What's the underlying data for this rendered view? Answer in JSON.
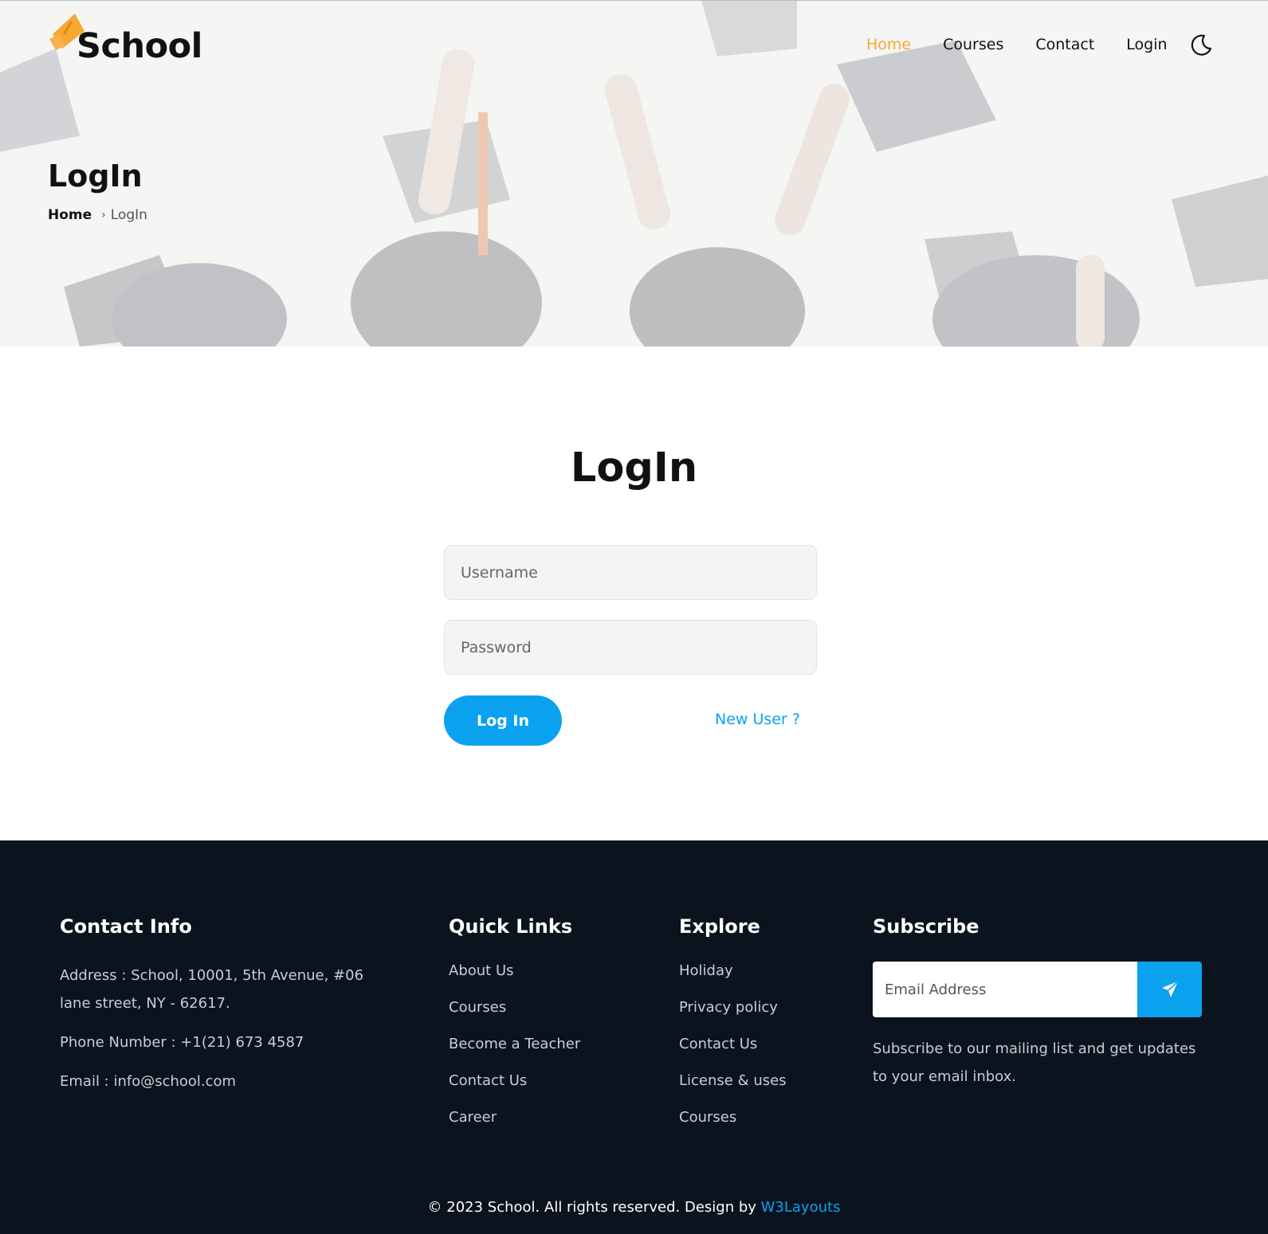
{
  "brand": {
    "name": "School",
    "accent_color": "#f7a833",
    "primary_color": "#0aa2ef",
    "footer_bg": "#0b131e"
  },
  "nav": {
    "items": [
      {
        "label": "Home",
        "active": true
      },
      {
        "label": "Courses",
        "active": false
      },
      {
        "label": "Contact",
        "active": false
      },
      {
        "label": "Login",
        "active": false
      }
    ],
    "theme_toggle_icon": "moon-icon"
  },
  "hero": {
    "title": "LogIn",
    "breadcrumb": {
      "home": "Home",
      "separator": "›",
      "current": "LogIn"
    }
  },
  "login": {
    "title": "LogIn",
    "username_placeholder": "Username",
    "password_placeholder": "Password",
    "submit_label": "Log In",
    "new_user_label": "New User ?"
  },
  "footer": {
    "contact": {
      "heading": "Contact Info",
      "address": "Address : School, 10001, 5th Avenue, #06 lane street, NY - 62617.",
      "phone": "Phone Number : +1(21) 673 4587",
      "email": "Email : info@school.com"
    },
    "quick_links": {
      "heading": "Quick Links",
      "items": [
        "About Us",
        "Courses",
        "Become a Teacher",
        "Contact Us",
        "Career"
      ]
    },
    "explore": {
      "heading": "Explore",
      "items": [
        "Holiday",
        "Privacy policy",
        "Contact Us",
        "License & uses",
        "Courses"
      ]
    },
    "subscribe": {
      "heading": "Subscribe",
      "email_placeholder": "Email Address",
      "send_icon": "paper-plane-icon",
      "text": "Subscribe to our mailing list and get updates to your email inbox."
    },
    "copyright": {
      "text": "© 2023 School. All rights reserved. Design by ",
      "link": "W3Layouts"
    }
  }
}
